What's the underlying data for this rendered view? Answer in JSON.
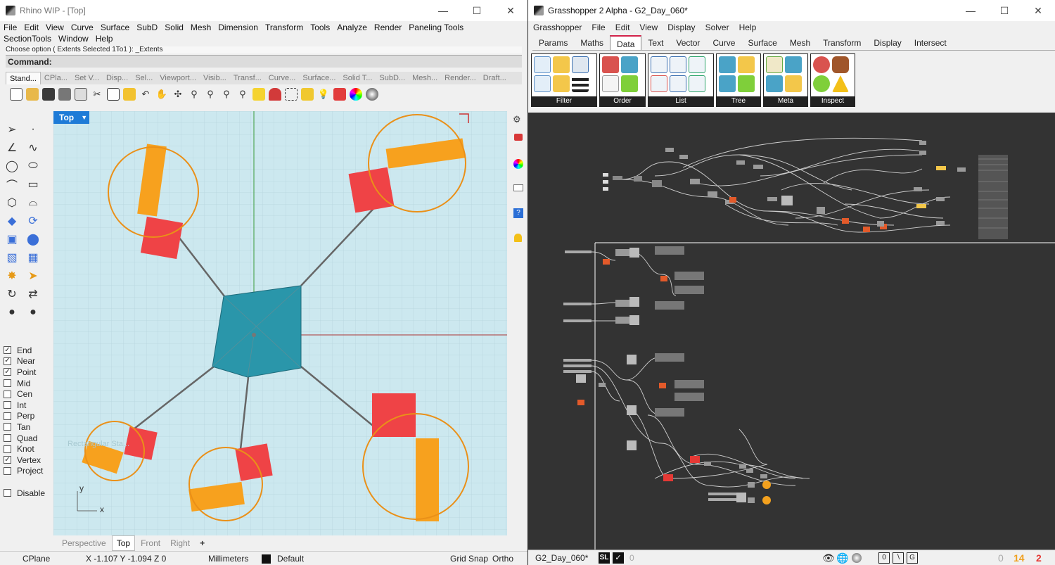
{
  "rhino": {
    "title": "Rhino WIP - [Top]",
    "menu": [
      "File",
      "Edit",
      "View",
      "Curve",
      "Surface",
      "SubD",
      "Solid",
      "Mesh",
      "Dimension",
      "Transform",
      "Tools",
      "Analyze",
      "Render",
      "Paneling Tools",
      "SectionTools",
      "Window",
      "Help"
    ],
    "command_history": "Choose option ( Extents  Selected  1To1 ): _Extents",
    "command_prompt": "Command:",
    "toolbar_tabs": [
      "Stand...",
      "CPla...",
      "Set V...",
      "Disp...",
      "Sel...",
      "Viewport...",
      "Visib...",
      "Transf...",
      "Curve...",
      "Surface...",
      "Solid T...",
      "SubD...",
      "Mesh...",
      "Render...",
      "Draft..."
    ],
    "toolbar_icons": [
      "new-icon",
      "open-icon",
      "save-icon",
      "print-icon",
      "import-icon",
      "cut-icon",
      "copy-icon",
      "paste-icon",
      "undo-icon",
      "pan-icon",
      "rotate-view-icon",
      "zoom-window-icon",
      "zoom-extents-icon",
      "zoom-selected-icon",
      "zoom-all-icon",
      "select-icon",
      "car-icon",
      "named-views-icon",
      "snapshot-icon",
      "lights-icon",
      "materials-icon",
      "color-wheel-icon",
      "render-icon"
    ],
    "viewport_label": "Top",
    "viewport_tabs": [
      "Perspective",
      "Top",
      "Front",
      "Right"
    ],
    "viewport_add": "+",
    "axis_x": "x",
    "axis_y": "y",
    "watermark": "Rectangular Sta...",
    "osnaps": [
      {
        "label": "End",
        "checked": true
      },
      {
        "label": "Near",
        "checked": true
      },
      {
        "label": "Point",
        "checked": true
      },
      {
        "label": "Mid",
        "checked": false
      },
      {
        "label": "Cen",
        "checked": false
      },
      {
        "label": "Int",
        "checked": false
      },
      {
        "label": "Perp",
        "checked": false
      },
      {
        "label": "Tan",
        "checked": false
      },
      {
        "label": "Quad",
        "checked": false
      },
      {
        "label": "Knot",
        "checked": false
      },
      {
        "label": "Vertex",
        "checked": true
      },
      {
        "label": "Project",
        "checked": false
      }
    ],
    "disable_label": "Disable",
    "status": {
      "cplane": "CPlane",
      "coords": "X -1.107  Y -1.094  Z 0",
      "units": "Millimeters",
      "layer": "Default",
      "grid_snap": "Grid Snap",
      "ortho": "Ortho"
    },
    "colors": {
      "viewport_bg": "#cce8ef",
      "hub": "#2a96aa",
      "square": "#ef4346",
      "bar": "#f7a11e",
      "circle": "#ea9018",
      "accent": "#1e7bd7"
    }
  },
  "grasshopper": {
    "title": "Grasshopper 2 Alpha - G2_Day_060*",
    "menu": [
      "Grasshopper",
      "File",
      "Edit",
      "View",
      "Display",
      "Solver",
      "Help"
    ],
    "tabs": [
      "Params",
      "Maths",
      "Data",
      "Text",
      "Vector",
      "Curve",
      "Surface",
      "Mesh",
      "Transform",
      "Display",
      "Intersect"
    ],
    "active_tab": "Data",
    "panels": [
      "Filter",
      "Order",
      "List",
      "Tree",
      "Meta",
      "Inspect"
    ],
    "status": {
      "file": "G2_Day_060*",
      "sl": "SL",
      "zero": "0",
      "count_a": "0",
      "count_b": "14",
      "count_c": "2"
    },
    "colors": {
      "canvas": "#333333",
      "error": "#e53935",
      "warning": "#f7a11e"
    }
  }
}
